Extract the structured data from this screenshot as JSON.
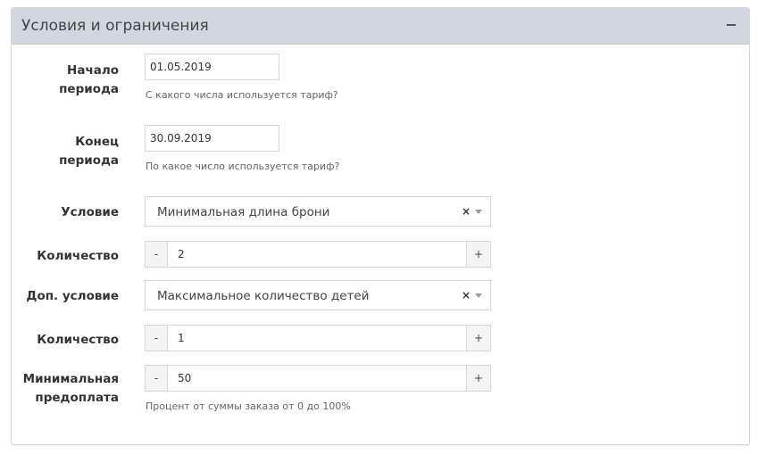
{
  "panel": {
    "title": "Условия и ограничения"
  },
  "form": {
    "start": {
      "label_line1": "Начало",
      "label_line2": "периода",
      "value": "01.05.2019",
      "help": "С какого числа используется тариф?"
    },
    "end": {
      "label_line1": "Конец",
      "label_line2": "периода",
      "value": "30.09.2019",
      "help": "По какое число используется тариф?"
    },
    "condition": {
      "label": "Условие",
      "selected": "Минимальная длина брони",
      "clear": "×"
    },
    "quantity1": {
      "label": "Количество",
      "minus": "-",
      "value": "2",
      "plus": "+"
    },
    "extra_condition": {
      "label": "Доп. условие",
      "selected": "Максимальное количество детей",
      "clear": "×"
    },
    "quantity2": {
      "label": "Количество",
      "minus": "-",
      "value": "1",
      "plus": "+"
    },
    "prepayment": {
      "label_line1": "Минимальная",
      "label_line2": "предоплата",
      "minus": "-",
      "value": "50",
      "plus": "+",
      "help": "Процент от суммы заказа от 0 до 100%"
    }
  }
}
